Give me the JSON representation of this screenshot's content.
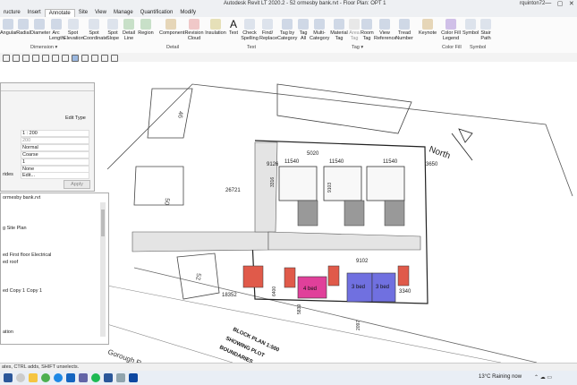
{
  "titlebar": {
    "title": "Autodesk Revit LT 2020.2 - 52 ormesby bank.rvt - Floor Plan: OPT 1",
    "user": "rquinton72",
    "controls": [
      "—",
      "▢",
      "✕"
    ]
  },
  "tabs": [
    {
      "label": "ructure",
      "active": false
    },
    {
      "label": "Insert",
      "active": false
    },
    {
      "label": "Annotate",
      "active": true
    },
    {
      "label": "Site",
      "active": false
    },
    {
      "label": "View",
      "active": false
    },
    {
      "label": "Manage",
      "active": false
    },
    {
      "label": "Quantification",
      "active": false
    },
    {
      "label": "Modify",
      "active": false
    }
  ],
  "ribbon": {
    "buttons": [
      {
        "label": "Angular",
        "icon": "angular-dimension-icon"
      },
      {
        "label": "Radial",
        "icon": "radial-dimension-icon"
      },
      {
        "label": "Diameter",
        "icon": "diameter-dimension-icon"
      },
      {
        "label": "Arc Length",
        "icon": "arc-length-icon"
      },
      {
        "label": "Spot Elevation",
        "icon": "spot-elevation-icon"
      },
      {
        "label": "Spot Coordinate",
        "icon": "spot-coordinate-icon"
      },
      {
        "label": "Spot Slope",
        "icon": "spot-slope-icon"
      },
      {
        "label": "Detail Line",
        "icon": "detail-line-icon"
      },
      {
        "label": "Region",
        "icon": "region-icon"
      },
      {
        "label": "Component",
        "icon": "component-icon"
      },
      {
        "label": "Revision Cloud",
        "icon": "revision-cloud-icon"
      },
      {
        "label": "Insulation",
        "icon": "insulation-icon"
      },
      {
        "label": "Text",
        "icon": "text-icon"
      },
      {
        "label": "Check Spelling",
        "icon": "check-spelling-icon"
      },
      {
        "label": "Find/ Replace",
        "icon": "find-replace-icon"
      },
      {
        "label": "Tag by Category",
        "icon": "tag-by-category-icon"
      },
      {
        "label": "Tag All",
        "icon": "tag-all-icon"
      },
      {
        "label": "Multi- Category",
        "icon": "multi-category-icon"
      },
      {
        "label": "Material Tag",
        "icon": "material-tag-icon"
      },
      {
        "label": "Area Tag",
        "icon": "area-tag-icon"
      },
      {
        "label": "Room Tag",
        "icon": "room-tag-icon"
      },
      {
        "label": "View Reference",
        "icon": "view-reference-icon"
      },
      {
        "label": "Tread Number",
        "icon": "tread-number-icon"
      },
      {
        "label": "Keynote",
        "icon": "keynote-icon"
      },
      {
        "label": "Color Fill Legend",
        "icon": "color-fill-legend-icon"
      },
      {
        "label": "Symbol",
        "icon": "symbol-icon"
      },
      {
        "label": "Stair Path",
        "icon": "stair-path-icon"
      }
    ],
    "panels": [
      "Dimension ▾",
      "Detail",
      "Text",
      "Tag ▾",
      "Color Fill",
      "Symbol"
    ]
  },
  "properties": {
    "edit_type": "Edit Type",
    "rows": [
      {
        "key": "",
        "value": "1 : 200"
      },
      {
        "key": "",
        "value": "200"
      },
      {
        "key": "",
        "value": "Normal"
      },
      {
        "key": "",
        "value": "Coarse"
      },
      {
        "key": "",
        "value": "1"
      },
      {
        "key": "",
        "value": "None"
      },
      {
        "key": "rides",
        "value": "Edit..."
      },
      {
        "key": "",
        "value": "Edit"
      }
    ],
    "apply": "Apply"
  },
  "browser": {
    "title": "ormesby bank.rvt",
    "items": [
      "g Site Plan",
      "",
      "ed First floor Electrical",
      "ed roof",
      "",
      "ed Copy 1 Copy 1",
      "",
      "",
      "",
      "ation"
    ]
  },
  "drawing": {
    "dimensions": [
      "9126",
      "11540",
      "11540",
      "11540",
      "3650",
      "26721",
      "9102",
      "18352",
      "6400",
      "5839",
      "2097",
      "9103",
      "5020",
      "3316",
      "3340"
    ],
    "labels": [
      "North",
      "46",
      "50",
      "52",
      "4 bed",
      "3 bed",
      "3 bed",
      "BLOCK PLAN 1:500",
      "SHOWING PLOT",
      "BOUNDARIES",
      "Gorough Rem"
    ]
  },
  "status": {
    "text": "ates, CTRL adds, SHIFT unselects."
  },
  "taskbar": {
    "weather": "13°C  Raining now",
    "icons": [
      "start-icon",
      "search-icon",
      "file-explorer-icon",
      "chrome-icon",
      "edge-icon",
      "store-icon",
      "teams-icon",
      "spotify-icon",
      "word-icon",
      "explorer-icon",
      "revit-icon"
    ]
  },
  "colors": {
    "accent": "#2b579a",
    "red_plot": "#e05a4a",
    "pink_plot": "#e0409a",
    "blue_plot": "#7070e0"
  }
}
